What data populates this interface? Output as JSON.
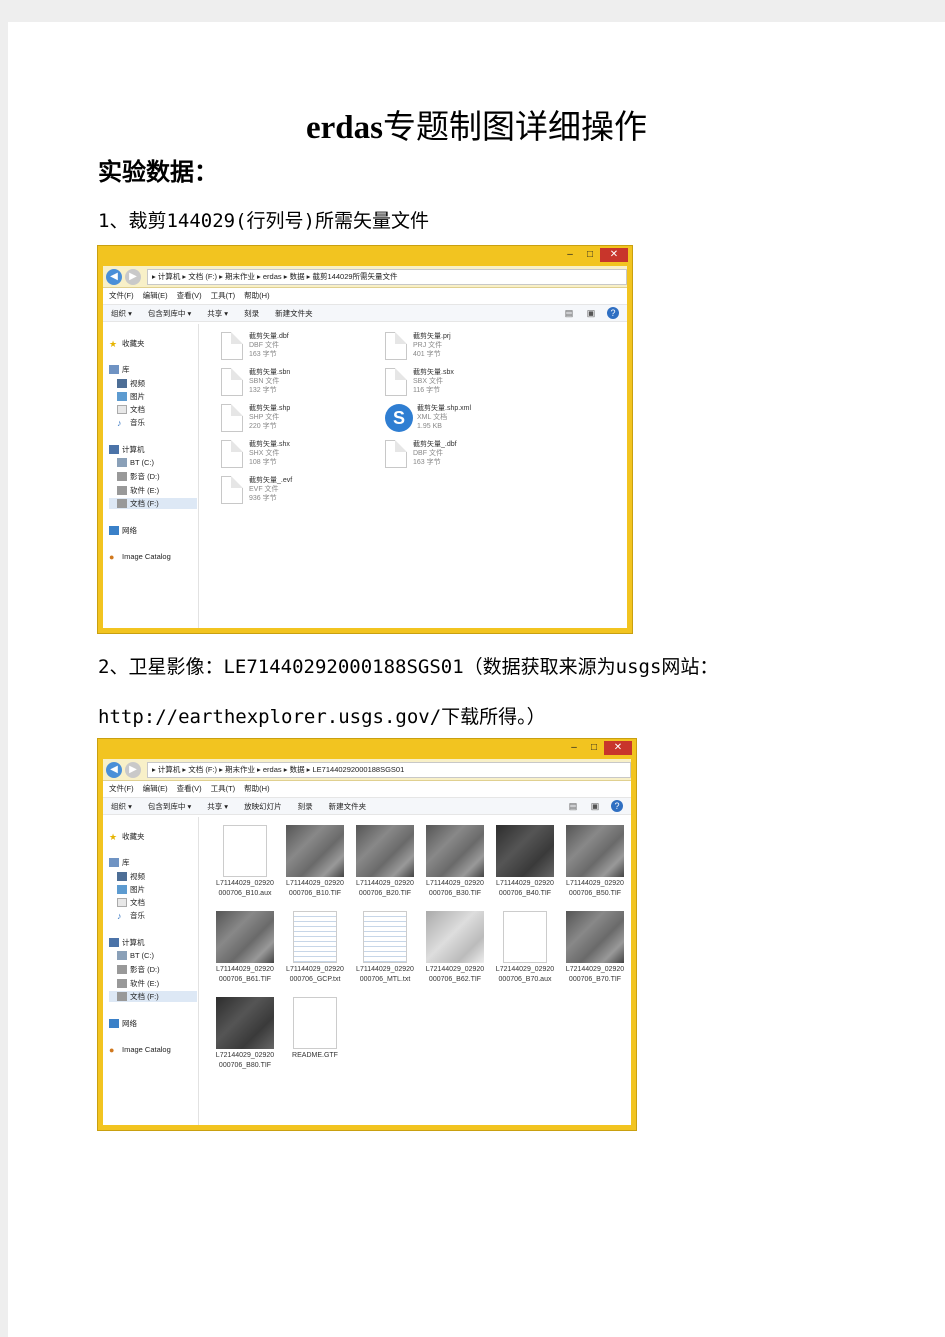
{
  "title": {
    "latin": "erdas",
    "cjk": "专题制图详细操作"
  },
  "section_heading": "实验数据：",
  "step1": "1、裁剪144029(行列号)所需矢量文件",
  "step2_line1": "2、卫星影像：LE71440292000188SGS01（数据获取来源为usgs网站：",
  "step2_line2": "http://earthexplorer.usgs.gov/下载所得。）",
  "window1": {
    "path": "▸ 计算机 ▸ 文档 (F:) ▸ 期末作业 ▸ erdas ▸ 数据 ▸ 截剪144029所需矢量文件",
    "menu": [
      "文件(F)",
      "编辑(E)",
      "查看(V)",
      "工具(T)",
      "帮助(H)"
    ],
    "toolbar": [
      "组织 ▾",
      "包含到库中 ▾",
      "共享 ▾",
      "刻录",
      "新建文件夹"
    ],
    "files": [
      {
        "name": "截剪矢量.dbf",
        "type": "DBF 文件",
        "size": "163 字节"
      },
      {
        "name": "截剪矢量.sbn",
        "type": "SBN 文件",
        "size": "132 字节"
      },
      {
        "name": "截剪矢量.shp",
        "type": "SHP 文件",
        "size": "220 字节"
      },
      {
        "name": "截剪矢量.shx",
        "type": "SHX 文件",
        "size": "108 字节"
      },
      {
        "name": "截剪矢量_.evf",
        "type": "EVF 文件",
        "size": "936 字节"
      },
      {
        "name": "截剪矢量.prj",
        "type": "PRJ 文件",
        "size": "401 字节"
      },
      {
        "name": "截剪矢量.sbx",
        "type": "SBX 文件",
        "size": "116 字节"
      },
      {
        "name": "截剪矢量.shp.xml",
        "type": "XML 文档",
        "size": "1.95 KB"
      },
      {
        "name": "截剪矢量_.dbf",
        "type": "DBF 文件",
        "size": "163 字节"
      }
    ]
  },
  "window2": {
    "path": "▸ 计算机 ▸ 文档 (F:) ▸ 期末作业 ▸ erdas ▸ 数据 ▸ LE71440292000188SGS01",
    "menu": [
      "文件(F)",
      "编辑(E)",
      "查看(V)",
      "工具(T)",
      "帮助(H)"
    ],
    "toolbar": [
      "组织 ▾",
      "包含到库中 ▾",
      "共享 ▾",
      "放映幻灯片",
      "刻录",
      "新建文件夹"
    ],
    "files": [
      {
        "l1": "L71144029_02920",
        "l2": "000706_B10.aux"
      },
      {
        "l1": "L71144029_02920",
        "l2": "000706_B10.TIF"
      },
      {
        "l1": "L71144029_02920",
        "l2": "000706_B20.TIF"
      },
      {
        "l1": "L71144029_02920",
        "l2": "000706_B30.TIF"
      },
      {
        "l1": "L71144029_02920",
        "l2": "000706_B40.TIF"
      },
      {
        "l1": "L71144029_02920",
        "l2": "000706_B50.TIF"
      },
      {
        "l1": "L71144029_02920",
        "l2": "000706_B61.TIF"
      },
      {
        "l1": "L71144029_02920",
        "l2": "000706_GCP.txt"
      },
      {
        "l1": "L71144029_02920",
        "l2": "000706_MTL.txt"
      },
      {
        "l1": "L72144029_02920",
        "l2": "000706_B62.TIF"
      },
      {
        "l1": "L72144029_02920",
        "l2": "000706_B70.aux"
      },
      {
        "l1": "L72144029_02920",
        "l2": "000706_B70.TIF"
      },
      {
        "l1": "L72144029_02920",
        "l2": "000706_B80.TIF"
      },
      {
        "l1": "README.GTF",
        "l2": ""
      }
    ]
  },
  "nav": {
    "favorites": "收藏夹",
    "library": "库",
    "videos": "视频",
    "pictures": "图片",
    "documents": "文档",
    "music": "音乐",
    "computer": "计算机",
    "drive_c": "BT (C:)",
    "drive_d": "影音 (D:)",
    "drive_e": "软件 (E:)",
    "drive_f": "文档 (F:)",
    "network": "网络",
    "image_catalog": "Image Catalog"
  }
}
